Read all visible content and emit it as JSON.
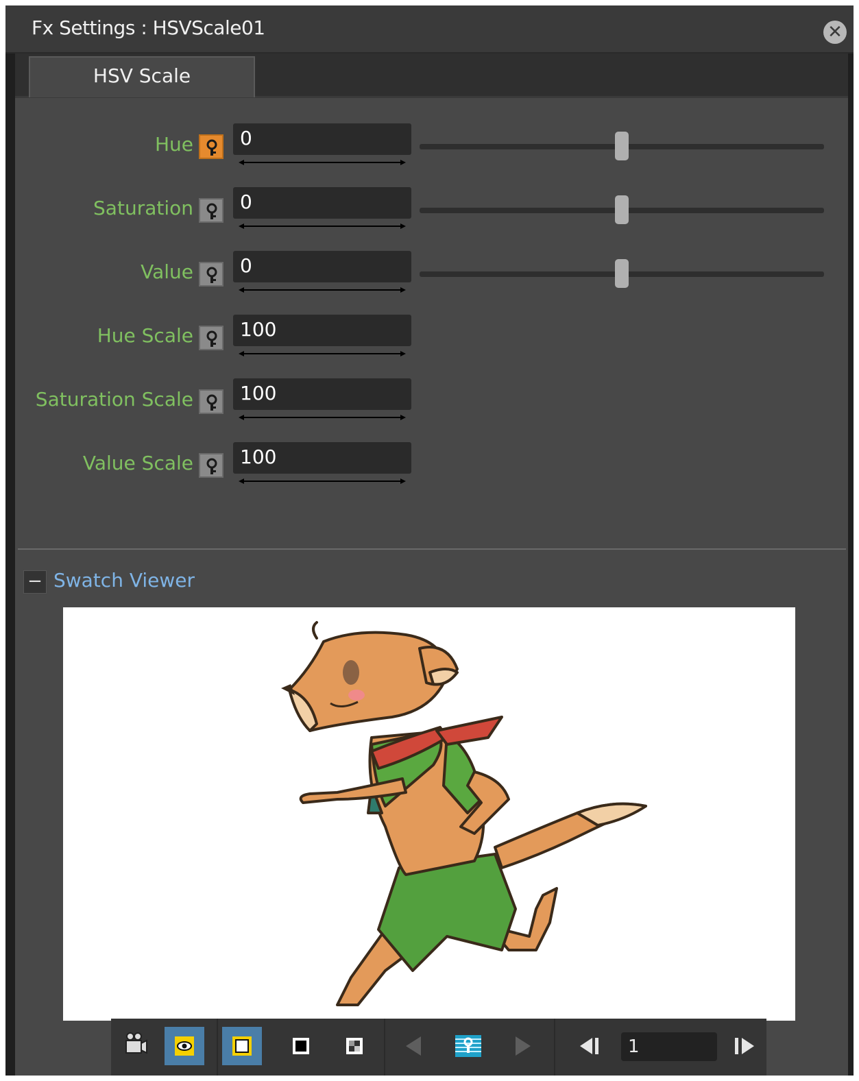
{
  "window": {
    "title": "Fx Settings : HSVScale01",
    "close_icon": "close-icon"
  },
  "tabs": [
    {
      "label": "HSV Scale",
      "active": true
    }
  ],
  "params": [
    {
      "label": "Hue",
      "value": "0",
      "keyframe_active": true,
      "slider": 0.5
    },
    {
      "label": "Saturation",
      "value": "0",
      "keyframe_active": false,
      "slider": 0.5
    },
    {
      "label": "Value",
      "value": "0",
      "keyframe_active": false,
      "slider": 0.5
    },
    {
      "label": "Hue Scale",
      "value": "100",
      "keyframe_active": false
    },
    {
      "label": "Saturation Scale",
      "value": "100",
      "keyframe_active": false
    },
    {
      "label": "Value Scale",
      "value": "100",
      "keyframe_active": false
    }
  ],
  "swatch": {
    "collapse_label": "−",
    "title": "Swatch Viewer",
    "preview_image": "running-dog-character"
  },
  "toolbar": {
    "buttons": [
      "camera-icon",
      "preview-eye-icon",
      "white-bg-icon",
      "black-bg-icon",
      "checkerboard-bg-icon",
      "prev-key-icon",
      "keyframe-icon",
      "next-key-icon",
      "prev-frame-icon",
      "next-frame-icon"
    ],
    "frame": "1"
  },
  "colors": {
    "label_green": "#80c060",
    "accent_blue": "#7fb4e6",
    "toggle_on": "#4a7ea8",
    "key_active": "#e58a2e"
  }
}
